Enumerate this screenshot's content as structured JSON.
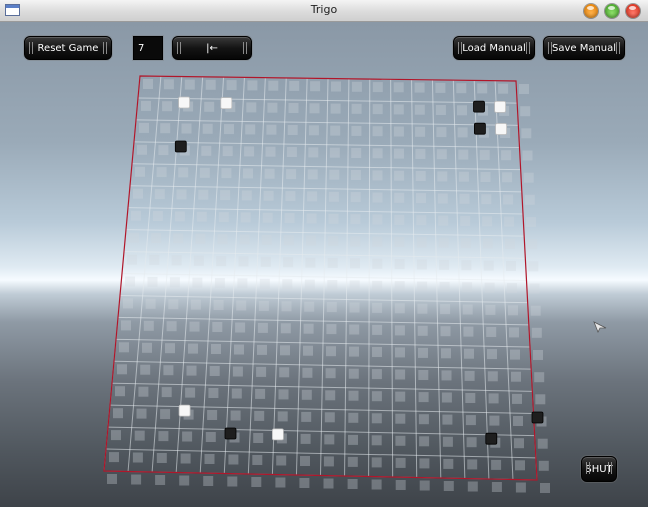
{
  "window": {
    "title": "Trigo",
    "controls": [
      "minimize",
      "maximize",
      "close"
    ]
  },
  "toolbar": {
    "reset_label": "Reset Game",
    "move_count": "7",
    "rewind_label": "|←",
    "load_label": "Load Manual",
    "save_label": "Save Manual"
  },
  "shut_label": "SHUT",
  "board": {
    "grid_size": 19,
    "outline_color": "#b0162a",
    "stones": [
      {
        "color": "white",
        "col": 2,
        "row": 1
      },
      {
        "color": "white",
        "col": 4,
        "row": 1
      },
      {
        "color": "black",
        "col": 2,
        "row": 3
      },
      {
        "color": "black",
        "col": 16,
        "row": 1
      },
      {
        "color": "white",
        "col": 17,
        "row": 1
      },
      {
        "color": "black",
        "col": 16,
        "row": 2
      },
      {
        "color": "white",
        "col": 17,
        "row": 2
      },
      {
        "color": "white",
        "col": 3,
        "row": 15
      },
      {
        "color": "black",
        "col": 5,
        "row": 16
      },
      {
        "color": "white",
        "col": 7,
        "row": 16
      },
      {
        "color": "black",
        "col": 16,
        "row": 16
      },
      {
        "color": "black",
        "col": 18,
        "row": 15
      }
    ]
  }
}
